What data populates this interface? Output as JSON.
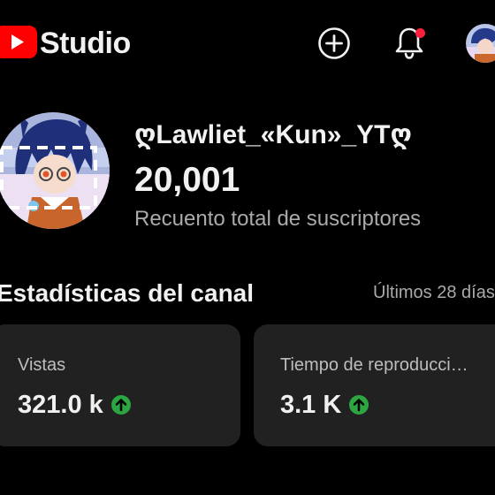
{
  "header": {
    "app_name": "Studio",
    "brand_color": "#ff0000",
    "icons": [
      "youtube-logo-icon",
      "create-plus-icon",
      "notification-bell-icon",
      "account-avatar"
    ],
    "notification_dot_color": "#ff1e3b"
  },
  "channel": {
    "name": "ღLawliet_«Kun»_YTღ",
    "subscriber_count": "20,001",
    "subscriber_label": "Recuento total de suscriptores"
  },
  "stats": {
    "title": "Estadísticas del canal",
    "period": "Últimos 28 días",
    "cards": [
      {
        "label": "Vistas",
        "value": "321.0 k",
        "trend": "up",
        "trend_color": "#2ba640"
      },
      {
        "label": "Tiempo de reproducción (horas)",
        "label_display": "Tiempo de reproducci…",
        "value": "3.1 K",
        "trend": "up",
        "trend_color": "#2ba640"
      }
    ]
  }
}
